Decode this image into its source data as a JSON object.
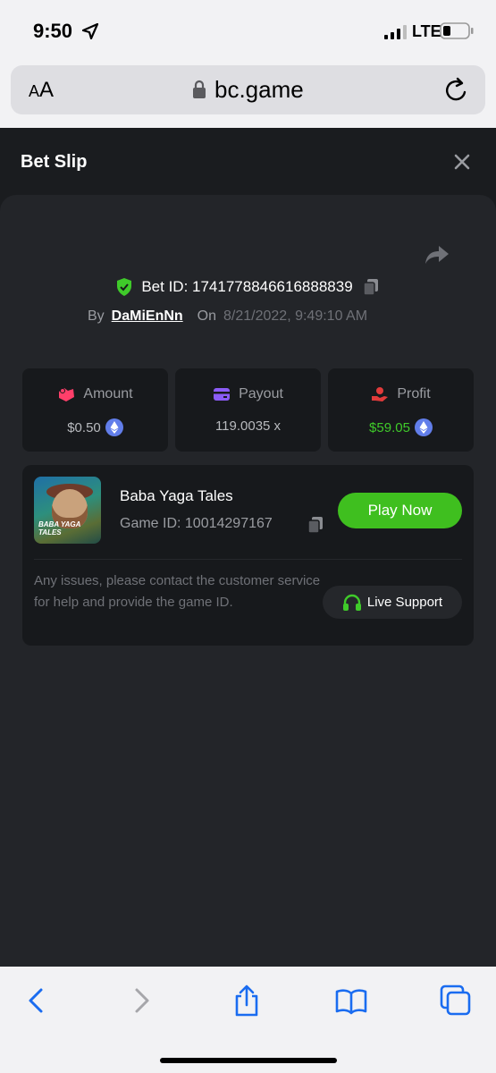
{
  "status_bar": {
    "time": "9:50",
    "network": "LTE"
  },
  "browser": {
    "text_size_label_small": "A",
    "text_size_label_large": "A",
    "url": "bc.game"
  },
  "bet_slip": {
    "title": "Bet Slip",
    "bet_id_label": "Bet ID: 1741778846616888839",
    "by_label": "By",
    "username": "DaMiEnNn",
    "on_label": "On",
    "datetime": "8/21/2022, 9:49:10 AM",
    "stats": [
      {
        "label": "Amount",
        "value": "$0.50",
        "icon": "amount-icon",
        "has_coin": true
      },
      {
        "label": "Payout",
        "value": "119.0035 x",
        "icon": "payout-card-icon",
        "has_coin": false
      },
      {
        "label": "Profit",
        "value": "$59.05",
        "icon": "profit-icon",
        "has_coin": true
      }
    ],
    "game": {
      "thumbnail_text": "BABA YAGA TALES",
      "name": "Baba Yaga Tales",
      "game_id_label": "Game ID: 10014297167",
      "play_button": "Play Now"
    },
    "issue_text": "Any issues, please contact the customer service for help and provide the game ID.",
    "support_button": "Live Support"
  },
  "colors": {
    "accent_green": "#3fbf1f",
    "profit_green": "#3fca2a",
    "background": "#1a1c1f",
    "card": "#17191c"
  }
}
